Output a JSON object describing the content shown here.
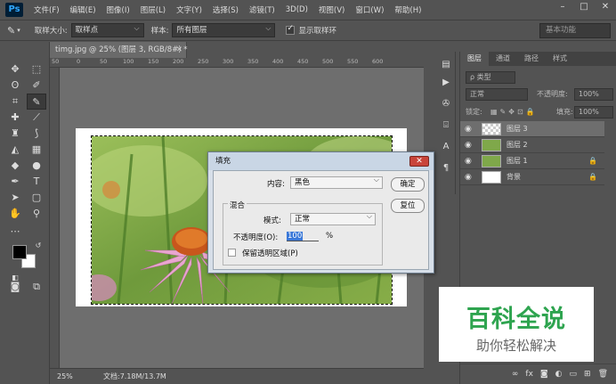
{
  "app": {
    "logo": "Ps"
  },
  "menu": [
    "文件(F)",
    "编辑(E)",
    "图像(I)",
    "图层(L)",
    "文字(Y)",
    "选择(S)",
    "滤镜(T)",
    "3D(D)",
    "视图(V)",
    "窗口(W)",
    "帮助(H)"
  ],
  "window_controls": {
    "minimize": "–",
    "maximize": "□",
    "close": "✕"
  },
  "options": {
    "sample_size_label": "取样大小:",
    "sample_size_value": "取样点",
    "sample_label": "样本:",
    "sample_value": "所有图层",
    "show_ring_label": "显示取样环",
    "show_ring_checked": true,
    "workspace": "基本功能"
  },
  "document": {
    "tab_title": "timg.jpg @ 25% (图层 3, RGB/8#) *",
    "ruler_ticks": [
      "50",
      "0",
      "50",
      "100",
      "150",
      "200",
      "250",
      "300",
      "350",
      "400",
      "450",
      "500",
      "550",
      "600"
    ],
    "zoom": "25%",
    "doc_info": "文档:7.18M/13.7M"
  },
  "panels": {
    "tabs": [
      "图层",
      "通道",
      "路径",
      "样式"
    ],
    "filter_label": "ρ 类型",
    "blend_mode": "正常",
    "opacity_label": "不透明度:",
    "opacity_value": "100%",
    "lock_label": "锁定:",
    "fill_label": "填充:",
    "fill_value": "100%",
    "layers": [
      {
        "name": "图层 3",
        "selected": true,
        "locked": false
      },
      {
        "name": "图层 2",
        "selected": false,
        "locked": false
      },
      {
        "name": "图层 1",
        "selected": false,
        "locked": true
      },
      {
        "name": "背景",
        "selected": false,
        "locked": true
      }
    ],
    "footer_icons": [
      "link-icon",
      "fx-icon",
      "mask-icon",
      "adjustment-icon",
      "group-icon",
      "new-layer-icon",
      "trash-icon"
    ]
  },
  "fill_dialog": {
    "title": "填充",
    "close": "✕",
    "contents_label": "内容:",
    "contents_value": "黑色",
    "ok_label": "确定",
    "reset_label": "复位",
    "blending_group": "混合",
    "mode_label": "模式:",
    "mode_value": "正常",
    "opacity_label": "不透明度(O):",
    "opacity_value": "100",
    "opacity_unit": "%",
    "preserve_label": "保留透明区域(P)",
    "preserve_checked": false
  },
  "watermark": {
    "title": "百科全说",
    "subtitle": "助你轻松解决"
  }
}
